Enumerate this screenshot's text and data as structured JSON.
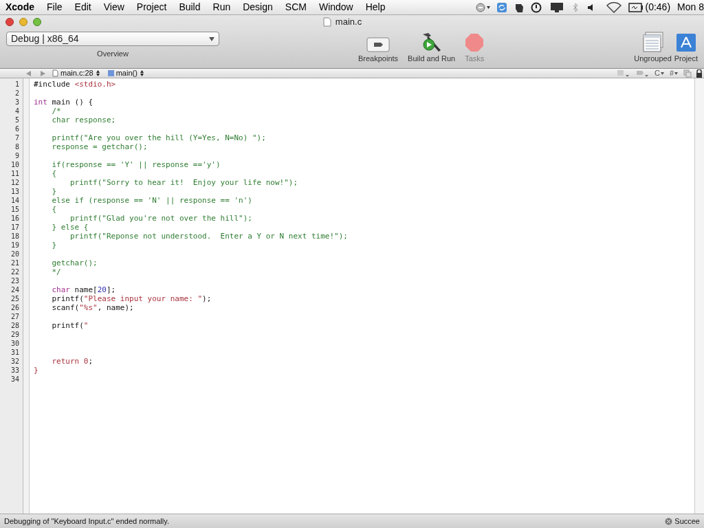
{
  "menu_bar": {
    "app": "Xcode",
    "items": [
      "File",
      "Edit",
      "View",
      "Project",
      "Build",
      "Run",
      "Design",
      "SCM",
      "Window",
      "Help"
    ],
    "battery": "(0:46)",
    "clock": "Mon 8"
  },
  "window": {
    "title": "main.c"
  },
  "toolbar": {
    "overview": {
      "value": "Debug | x86_64",
      "label": "Overview"
    },
    "tools": [
      {
        "kind": "breakpoints",
        "label": "Breakpoints",
        "disabled": false
      },
      {
        "kind": "build",
        "label": "Build and Run",
        "disabled": false
      },
      {
        "kind": "tasks",
        "label": "Tasks",
        "disabled": true
      }
    ],
    "right_tools": [
      {
        "kind": "ungrouped",
        "label": "Ungrouped"
      },
      {
        "kind": "project",
        "label": "Project"
      }
    ]
  },
  "nav_bar": {
    "file": "main.c:28",
    "function": "main()",
    "menus": [
      "C",
      "#"
    ]
  },
  "code": [
    {
      "number": "1",
      "segments": [
        {
          "kind": "plain",
          "text": "#include "
        },
        {
          "kind": "string",
          "text": "<stdio.h>"
        }
      ]
    },
    {
      "number": "2"
    },
    {
      "number": "3",
      "segments": [
        {
          "kind": "keyword",
          "text": "int"
        },
        {
          "kind": "plain",
          "text": " main () {"
        }
      ]
    },
    {
      "number": "4",
      "segments": [
        {
          "kind": "comment",
          "text": "    /*"
        }
      ]
    },
    {
      "number": "5",
      "segments": [
        {
          "kind": "comment",
          "text": "    char response;"
        }
      ]
    },
    {
      "number": "6"
    },
    {
      "number": "7",
      "segments": [
        {
          "kind": "comment",
          "text": "    printf(\"Are you over the hill (Y=Yes, N=No) \");"
        }
      ]
    },
    {
      "number": "8",
      "segments": [
        {
          "kind": "comment",
          "text": "    response = getchar();"
        }
      ]
    },
    {
      "number": "9"
    },
    {
      "number": "10",
      "segments": [
        {
          "kind": "comment",
          "text": "    if(response == 'Y' || response =='y')"
        }
      ]
    },
    {
      "number": "11",
      "segments": [
        {
          "kind": "comment",
          "text": "    {"
        }
      ]
    },
    {
      "number": "12",
      "segments": [
        {
          "kind": "comment",
          "text": "        printf(\"Sorry to hear it!  Enjoy your life now!\");"
        }
      ]
    },
    {
      "number": "13",
      "segments": [
        {
          "kind": "comment",
          "text": "    }"
        }
      ]
    },
    {
      "number": "14",
      "segments": [
        {
          "kind": "comment",
          "text": "    else if (response == 'N' || response == 'n')"
        }
      ]
    },
    {
      "number": "15",
      "segments": [
        {
          "kind": "comment",
          "text": "    {"
        }
      ]
    },
    {
      "number": "16",
      "segments": [
        {
          "kind": "comment",
          "text": "        printf(\"Glad you're not over the hill\");"
        }
      ]
    },
    {
      "number": "17",
      "segments": [
        {
          "kind": "comment",
          "text": "    } else {"
        }
      ]
    },
    {
      "number": "18",
      "segments": [
        {
          "kind": "comment",
          "text": "        printf(\"Reponse not understood.  Enter a Y or N next time!\");"
        }
      ]
    },
    {
      "number": "19",
      "segments": [
        {
          "kind": "comment",
          "text": "    }"
        }
      ]
    },
    {
      "number": "20"
    },
    {
      "number": "21",
      "segments": [
        {
          "kind": "comment",
          "text": "    getchar();"
        }
      ]
    },
    {
      "number": "22",
      "segments": [
        {
          "kind": "comment",
          "text": "    */"
        }
      ]
    },
    {
      "number": "23"
    },
    {
      "number": "24",
      "segments": [
        {
          "kind": "keyword",
          "text": "    char"
        },
        {
          "kind": "plain",
          "text": " name["
        },
        {
          "kind": "number",
          "text": "20"
        },
        {
          "kind": "plain",
          "text": "];"
        }
      ]
    },
    {
      "number": "25",
      "segments": [
        {
          "kind": "plain",
          "text": "    printf("
        },
        {
          "kind": "string",
          "text": "\"Please input your name: \""
        },
        {
          "kind": "plain",
          "text": ");"
        }
      ]
    },
    {
      "number": "26",
      "segments": [
        {
          "kind": "plain",
          "text": "    scanf("
        },
        {
          "kind": "string",
          "text": "\"%s\""
        },
        {
          "kind": "plain",
          "text": ", name);"
        }
      ]
    },
    {
      "number": "27"
    },
    {
      "number": "28",
      "segments": [
        {
          "kind": "plain",
          "text": "    printf("
        },
        {
          "kind": "string",
          "text": "\""
        }
      ]
    },
    {
      "number": "29"
    },
    {
      "number": "30"
    },
    {
      "number": "31"
    },
    {
      "number": "32",
      "segments": [
        {
          "kind": "string",
          "text": "    return 0"
        },
        {
          "kind": "plain",
          "text": ";"
        }
      ]
    },
    {
      "number": "33",
      "segments": [
        {
          "kind": "string",
          "text": "}"
        }
      ]
    },
    {
      "number": "34"
    }
  ],
  "status_bar": {
    "message": "Debugging of \"Keyboard Input.c\" ended normally.",
    "result": "Succee"
  }
}
